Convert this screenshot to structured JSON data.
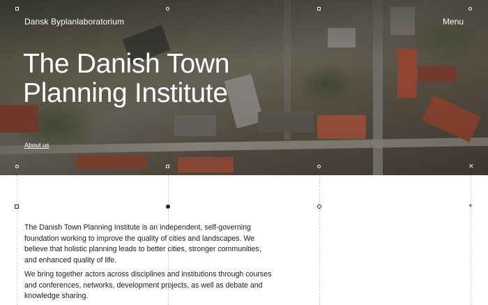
{
  "header": {
    "brand": "Dansk Byplanlaboratorium",
    "menu_label": "Menu"
  },
  "hero": {
    "title": "The Danish Town Planning Institute",
    "about_link": "About us"
  },
  "intro": {
    "paragraphs": [
      "The Danish Town Planning Institute is an independent, self-governing foundation working to improve the quality of cities and landscapes. We believe that holistic planning leads to better cities, stronger communities, and enhanced quality of life.",
      "We bring together actors across disciplines and institutions through courses and conferences, networks, development projects, as well as debate and knowledge sharing."
    ]
  },
  "icons": {
    "grid_markers": [
      "square-marker",
      "dot-marker",
      "ring-marker",
      "plus-marker"
    ]
  }
}
